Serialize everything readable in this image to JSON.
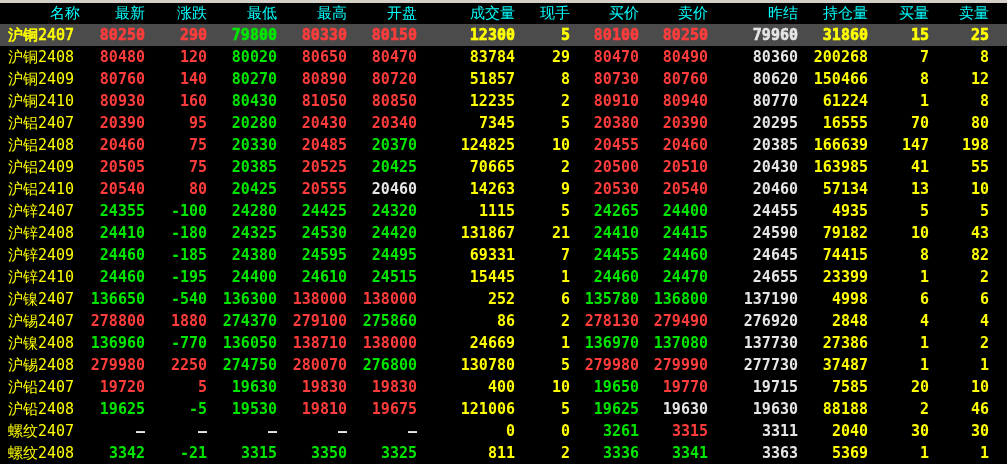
{
  "table": {
    "columns": [
      "名称",
      "最新",
      "涨跌",
      "最低",
      "最高",
      "开盘",
      "成交量",
      "现手",
      "买价",
      "卖价",
      "昨结",
      "持仓量",
      "买量",
      "卖量"
    ],
    "rows": [
      {
        "selected": true,
        "cells": [
          {
            "text": "沪铜2407",
            "color": "#ffff00"
          },
          {
            "text": "80250",
            "color": "#ff3c3c"
          },
          {
            "text": "290",
            "color": "#ff3c3c"
          },
          {
            "text": "79800",
            "color": "#00e600"
          },
          {
            "text": "80330",
            "color": "#ff3c3c"
          },
          {
            "text": "80150",
            "color": "#ff3c3c"
          },
          {
            "text": "12300",
            "color": "#ffff00"
          },
          {
            "text": "5",
            "color": "#ffff00"
          },
          {
            "text": "80100",
            "color": "#ff3c3c"
          },
          {
            "text": "80250",
            "color": "#ff3c3c"
          },
          {
            "text": "79960",
            "color": "#e6e6e6"
          },
          {
            "text": "31860",
            "color": "#ffff00"
          },
          {
            "text": "15",
            "color": "#ffff00"
          },
          {
            "text": "25",
            "color": "#ffff00"
          }
        ]
      },
      {
        "selected": false,
        "cells": [
          {
            "text": "沪铜2408",
            "color": "#ffff00"
          },
          {
            "text": "80480",
            "color": "#ff3c3c"
          },
          {
            "text": "120",
            "color": "#ff3c3c"
          },
          {
            "text": "80020",
            "color": "#00e600"
          },
          {
            "text": "80650",
            "color": "#ff3c3c"
          },
          {
            "text": "80470",
            "color": "#ff3c3c"
          },
          {
            "text": "83784",
            "color": "#ffff00"
          },
          {
            "text": "29",
            "color": "#ffff00"
          },
          {
            "text": "80470",
            "color": "#ff3c3c"
          },
          {
            "text": "80490",
            "color": "#ff3c3c"
          },
          {
            "text": "80360",
            "color": "#e6e6e6"
          },
          {
            "text": "200268",
            "color": "#ffff00"
          },
          {
            "text": "7",
            "color": "#ffff00"
          },
          {
            "text": "8",
            "color": "#ffff00"
          }
        ]
      },
      {
        "selected": false,
        "cells": [
          {
            "text": "沪铜2409",
            "color": "#ffff00"
          },
          {
            "text": "80760",
            "color": "#ff3c3c"
          },
          {
            "text": "140",
            "color": "#ff3c3c"
          },
          {
            "text": "80270",
            "color": "#00e600"
          },
          {
            "text": "80890",
            "color": "#ff3c3c"
          },
          {
            "text": "80720",
            "color": "#ff3c3c"
          },
          {
            "text": "51857",
            "color": "#ffff00"
          },
          {
            "text": "8",
            "color": "#ffff00"
          },
          {
            "text": "80730",
            "color": "#ff3c3c"
          },
          {
            "text": "80760",
            "color": "#ff3c3c"
          },
          {
            "text": "80620",
            "color": "#e6e6e6"
          },
          {
            "text": "150466",
            "color": "#ffff00"
          },
          {
            "text": "8",
            "color": "#ffff00"
          },
          {
            "text": "12",
            "color": "#ffff00"
          }
        ]
      },
      {
        "selected": false,
        "cells": [
          {
            "text": "沪铜2410",
            "color": "#ffff00"
          },
          {
            "text": "80930",
            "color": "#ff3c3c"
          },
          {
            "text": "160",
            "color": "#ff3c3c"
          },
          {
            "text": "80430",
            "color": "#00e600"
          },
          {
            "text": "81050",
            "color": "#ff3c3c"
          },
          {
            "text": "80850",
            "color": "#ff3c3c"
          },
          {
            "text": "12235",
            "color": "#ffff00"
          },
          {
            "text": "2",
            "color": "#ffff00"
          },
          {
            "text": "80910",
            "color": "#ff3c3c"
          },
          {
            "text": "80940",
            "color": "#ff3c3c"
          },
          {
            "text": "80770",
            "color": "#e6e6e6"
          },
          {
            "text": "61224",
            "color": "#ffff00"
          },
          {
            "text": "1",
            "color": "#ffff00"
          },
          {
            "text": "8",
            "color": "#ffff00"
          }
        ]
      },
      {
        "selected": false,
        "cells": [
          {
            "text": "沪铝2407",
            "color": "#ffff00"
          },
          {
            "text": "20390",
            "color": "#ff3c3c"
          },
          {
            "text": "95",
            "color": "#ff3c3c"
          },
          {
            "text": "20280",
            "color": "#00e600"
          },
          {
            "text": "20430",
            "color": "#ff3c3c"
          },
          {
            "text": "20340",
            "color": "#ff3c3c"
          },
          {
            "text": "7345",
            "color": "#ffff00"
          },
          {
            "text": "5",
            "color": "#ffff00"
          },
          {
            "text": "20380",
            "color": "#ff3c3c"
          },
          {
            "text": "20390",
            "color": "#ff3c3c"
          },
          {
            "text": "20295",
            "color": "#e6e6e6"
          },
          {
            "text": "16555",
            "color": "#ffff00"
          },
          {
            "text": "70",
            "color": "#ffff00"
          },
          {
            "text": "80",
            "color": "#ffff00"
          }
        ]
      },
      {
        "selected": false,
        "cells": [
          {
            "text": "沪铝2408",
            "color": "#ffff00"
          },
          {
            "text": "20460",
            "color": "#ff3c3c"
          },
          {
            "text": "75",
            "color": "#ff3c3c"
          },
          {
            "text": "20330",
            "color": "#00e600"
          },
          {
            "text": "20485",
            "color": "#ff3c3c"
          },
          {
            "text": "20370",
            "color": "#00e600"
          },
          {
            "text": "124825",
            "color": "#ffff00"
          },
          {
            "text": "10",
            "color": "#ffff00"
          },
          {
            "text": "20455",
            "color": "#ff3c3c"
          },
          {
            "text": "20460",
            "color": "#ff3c3c"
          },
          {
            "text": "20385",
            "color": "#e6e6e6"
          },
          {
            "text": "166639",
            "color": "#ffff00"
          },
          {
            "text": "147",
            "color": "#ffff00"
          },
          {
            "text": "198",
            "color": "#ffff00"
          }
        ]
      },
      {
        "selected": false,
        "cells": [
          {
            "text": "沪铝2409",
            "color": "#ffff00"
          },
          {
            "text": "20505",
            "color": "#ff3c3c"
          },
          {
            "text": "75",
            "color": "#ff3c3c"
          },
          {
            "text": "20385",
            "color": "#00e600"
          },
          {
            "text": "20525",
            "color": "#ff3c3c"
          },
          {
            "text": "20425",
            "color": "#00e600"
          },
          {
            "text": "70665",
            "color": "#ffff00"
          },
          {
            "text": "2",
            "color": "#ffff00"
          },
          {
            "text": "20500",
            "color": "#ff3c3c"
          },
          {
            "text": "20510",
            "color": "#ff3c3c"
          },
          {
            "text": "20430",
            "color": "#e6e6e6"
          },
          {
            "text": "163985",
            "color": "#ffff00"
          },
          {
            "text": "41",
            "color": "#ffff00"
          },
          {
            "text": "55",
            "color": "#ffff00"
          }
        ]
      },
      {
        "selected": false,
        "cells": [
          {
            "text": "沪铝2410",
            "color": "#ffff00"
          },
          {
            "text": "20540",
            "color": "#ff3c3c"
          },
          {
            "text": "80",
            "color": "#ff3c3c"
          },
          {
            "text": "20425",
            "color": "#00e600"
          },
          {
            "text": "20555",
            "color": "#ff3c3c"
          },
          {
            "text": "20460",
            "color": "#e6e6e6"
          },
          {
            "text": "14263",
            "color": "#ffff00"
          },
          {
            "text": "9",
            "color": "#ffff00"
          },
          {
            "text": "20530",
            "color": "#ff3c3c"
          },
          {
            "text": "20540",
            "color": "#ff3c3c"
          },
          {
            "text": "20460",
            "color": "#e6e6e6"
          },
          {
            "text": "57134",
            "color": "#ffff00"
          },
          {
            "text": "13",
            "color": "#ffff00"
          },
          {
            "text": "10",
            "color": "#ffff00"
          }
        ]
      },
      {
        "selected": false,
        "cells": [
          {
            "text": "沪锌2407",
            "color": "#ffff00"
          },
          {
            "text": "24355",
            "color": "#00e600"
          },
          {
            "text": "-100",
            "color": "#00e600"
          },
          {
            "text": "24280",
            "color": "#00e600"
          },
          {
            "text": "24425",
            "color": "#00e600"
          },
          {
            "text": "24320",
            "color": "#00e600"
          },
          {
            "text": "1115",
            "color": "#ffff00"
          },
          {
            "text": "5",
            "color": "#ffff00"
          },
          {
            "text": "24265",
            "color": "#00e600"
          },
          {
            "text": "24400",
            "color": "#00e600"
          },
          {
            "text": "24455",
            "color": "#e6e6e6"
          },
          {
            "text": "4935",
            "color": "#ffff00"
          },
          {
            "text": "5",
            "color": "#ffff00"
          },
          {
            "text": "5",
            "color": "#ffff00"
          }
        ]
      },
      {
        "selected": false,
        "cells": [
          {
            "text": "沪锌2408",
            "color": "#ffff00"
          },
          {
            "text": "24410",
            "color": "#00e600"
          },
          {
            "text": "-180",
            "color": "#00e600"
          },
          {
            "text": "24325",
            "color": "#00e600"
          },
          {
            "text": "24530",
            "color": "#00e600"
          },
          {
            "text": "24420",
            "color": "#00e600"
          },
          {
            "text": "131867",
            "color": "#ffff00"
          },
          {
            "text": "21",
            "color": "#ffff00"
          },
          {
            "text": "24410",
            "color": "#00e600"
          },
          {
            "text": "24415",
            "color": "#00e600"
          },
          {
            "text": "24590",
            "color": "#e6e6e6"
          },
          {
            "text": "79182",
            "color": "#ffff00"
          },
          {
            "text": "10",
            "color": "#ffff00"
          },
          {
            "text": "43",
            "color": "#ffff00"
          }
        ]
      },
      {
        "selected": false,
        "cells": [
          {
            "text": "沪锌2409",
            "color": "#ffff00"
          },
          {
            "text": "24460",
            "color": "#00e600"
          },
          {
            "text": "-185",
            "color": "#00e600"
          },
          {
            "text": "24380",
            "color": "#00e600"
          },
          {
            "text": "24595",
            "color": "#00e600"
          },
          {
            "text": "24495",
            "color": "#00e600"
          },
          {
            "text": "69331",
            "color": "#ffff00"
          },
          {
            "text": "7",
            "color": "#ffff00"
          },
          {
            "text": "24455",
            "color": "#00e600"
          },
          {
            "text": "24460",
            "color": "#00e600"
          },
          {
            "text": "24645",
            "color": "#e6e6e6"
          },
          {
            "text": "74415",
            "color": "#ffff00"
          },
          {
            "text": "8",
            "color": "#ffff00"
          },
          {
            "text": "82",
            "color": "#ffff00"
          }
        ]
      },
      {
        "selected": false,
        "cells": [
          {
            "text": "沪锌2410",
            "color": "#ffff00"
          },
          {
            "text": "24460",
            "color": "#00e600"
          },
          {
            "text": "-195",
            "color": "#00e600"
          },
          {
            "text": "24400",
            "color": "#00e600"
          },
          {
            "text": "24610",
            "color": "#00e600"
          },
          {
            "text": "24515",
            "color": "#00e600"
          },
          {
            "text": "15445",
            "color": "#ffff00"
          },
          {
            "text": "1",
            "color": "#ffff00"
          },
          {
            "text": "24460",
            "color": "#00e600"
          },
          {
            "text": "24470",
            "color": "#00e600"
          },
          {
            "text": "24655",
            "color": "#e6e6e6"
          },
          {
            "text": "23399",
            "color": "#ffff00"
          },
          {
            "text": "1",
            "color": "#ffff00"
          },
          {
            "text": "2",
            "color": "#ffff00"
          }
        ]
      },
      {
        "selected": false,
        "cells": [
          {
            "text": "沪镍2407",
            "color": "#ffff00"
          },
          {
            "text": "136650",
            "color": "#00e600"
          },
          {
            "text": "-540",
            "color": "#00e600"
          },
          {
            "text": "136300",
            "color": "#00e600"
          },
          {
            "text": "138000",
            "color": "#ff3c3c"
          },
          {
            "text": "138000",
            "color": "#ff3c3c"
          },
          {
            "text": "252",
            "color": "#ffff00"
          },
          {
            "text": "6",
            "color": "#ffff00"
          },
          {
            "text": "135780",
            "color": "#00e600"
          },
          {
            "text": "136800",
            "color": "#00e600"
          },
          {
            "text": "137190",
            "color": "#e6e6e6"
          },
          {
            "text": "4998",
            "color": "#ffff00"
          },
          {
            "text": "6",
            "color": "#ffff00"
          },
          {
            "text": "6",
            "color": "#ffff00"
          }
        ]
      },
      {
        "selected": false,
        "cells": [
          {
            "text": "沪锡2407",
            "color": "#ffff00"
          },
          {
            "text": "278800",
            "color": "#ff3c3c"
          },
          {
            "text": "1880",
            "color": "#ff3c3c"
          },
          {
            "text": "274370",
            "color": "#00e600"
          },
          {
            "text": "279100",
            "color": "#ff3c3c"
          },
          {
            "text": "275860",
            "color": "#00e600"
          },
          {
            "text": "86",
            "color": "#ffff00"
          },
          {
            "text": "2",
            "color": "#ffff00"
          },
          {
            "text": "278130",
            "color": "#ff3c3c"
          },
          {
            "text": "279490",
            "color": "#ff3c3c"
          },
          {
            "text": "276920",
            "color": "#e6e6e6"
          },
          {
            "text": "2848",
            "color": "#ffff00"
          },
          {
            "text": "4",
            "color": "#ffff00"
          },
          {
            "text": "4",
            "color": "#ffff00"
          }
        ]
      },
      {
        "selected": false,
        "cells": [
          {
            "text": "沪镍2408",
            "color": "#ffff00"
          },
          {
            "text": "136960",
            "color": "#00e600"
          },
          {
            "text": "-770",
            "color": "#00e600"
          },
          {
            "text": "136050",
            "color": "#00e600"
          },
          {
            "text": "138710",
            "color": "#ff3c3c"
          },
          {
            "text": "138000",
            "color": "#ff3c3c"
          },
          {
            "text": "24669",
            "color": "#ffff00"
          },
          {
            "text": "1",
            "color": "#ffff00"
          },
          {
            "text": "136970",
            "color": "#00e600"
          },
          {
            "text": "137080",
            "color": "#00e600"
          },
          {
            "text": "137730",
            "color": "#e6e6e6"
          },
          {
            "text": "27386",
            "color": "#ffff00"
          },
          {
            "text": "1",
            "color": "#ffff00"
          },
          {
            "text": "2",
            "color": "#ffff00"
          }
        ]
      },
      {
        "selected": false,
        "cells": [
          {
            "text": "沪锡2408",
            "color": "#ffff00"
          },
          {
            "text": "279980",
            "color": "#ff3c3c"
          },
          {
            "text": "2250",
            "color": "#ff3c3c"
          },
          {
            "text": "274750",
            "color": "#00e600"
          },
          {
            "text": "280070",
            "color": "#ff3c3c"
          },
          {
            "text": "276800",
            "color": "#00e600"
          },
          {
            "text": "130780",
            "color": "#ffff00"
          },
          {
            "text": "5",
            "color": "#ffff00"
          },
          {
            "text": "279980",
            "color": "#ff3c3c"
          },
          {
            "text": "279990",
            "color": "#ff3c3c"
          },
          {
            "text": "277730",
            "color": "#e6e6e6"
          },
          {
            "text": "37487",
            "color": "#ffff00"
          },
          {
            "text": "1",
            "color": "#ffff00"
          },
          {
            "text": "1",
            "color": "#ffff00"
          }
        ]
      },
      {
        "selected": false,
        "cells": [
          {
            "text": "沪铅2407",
            "color": "#ffff00"
          },
          {
            "text": "19720",
            "color": "#ff3c3c"
          },
          {
            "text": "5",
            "color": "#ff3c3c"
          },
          {
            "text": "19630",
            "color": "#00e600"
          },
          {
            "text": "19830",
            "color": "#ff3c3c"
          },
          {
            "text": "19830",
            "color": "#ff3c3c"
          },
          {
            "text": "400",
            "color": "#ffff00"
          },
          {
            "text": "10",
            "color": "#ffff00"
          },
          {
            "text": "19650",
            "color": "#00e600"
          },
          {
            "text": "19770",
            "color": "#ff3c3c"
          },
          {
            "text": "19715",
            "color": "#e6e6e6"
          },
          {
            "text": "7585",
            "color": "#ffff00"
          },
          {
            "text": "20",
            "color": "#ffff00"
          },
          {
            "text": "10",
            "color": "#ffff00"
          }
        ]
      },
      {
        "selected": false,
        "cells": [
          {
            "text": "沪铅2408",
            "color": "#ffff00"
          },
          {
            "text": "19625",
            "color": "#00e600"
          },
          {
            "text": "-5",
            "color": "#00e600"
          },
          {
            "text": "19530",
            "color": "#00e600"
          },
          {
            "text": "19810",
            "color": "#ff3c3c"
          },
          {
            "text": "19675",
            "color": "#ff3c3c"
          },
          {
            "text": "121006",
            "color": "#ffff00"
          },
          {
            "text": "5",
            "color": "#ffff00"
          },
          {
            "text": "19625",
            "color": "#00e600"
          },
          {
            "text": "19630",
            "color": "#e6e6e6"
          },
          {
            "text": "19630",
            "color": "#e6e6e6"
          },
          {
            "text": "88188",
            "color": "#ffff00"
          },
          {
            "text": "2",
            "color": "#ffff00"
          },
          {
            "text": "46",
            "color": "#ffff00"
          }
        ]
      },
      {
        "selected": false,
        "cells": [
          {
            "text": "螺纹2407",
            "color": "#ffff00"
          },
          {
            "text": "—",
            "color": "#e6e6e6"
          },
          {
            "text": "—",
            "color": "#e6e6e6"
          },
          {
            "text": "—",
            "color": "#e6e6e6"
          },
          {
            "text": "—",
            "color": "#e6e6e6"
          },
          {
            "text": "—",
            "color": "#e6e6e6"
          },
          {
            "text": "0",
            "color": "#ffff00"
          },
          {
            "text": "0",
            "color": "#ffff00"
          },
          {
            "text": "3261",
            "color": "#00e600"
          },
          {
            "text": "3315",
            "color": "#ff3c3c"
          },
          {
            "text": "3311",
            "color": "#e6e6e6"
          },
          {
            "text": "2040",
            "color": "#ffff00"
          },
          {
            "text": "30",
            "color": "#ffff00"
          },
          {
            "text": "30",
            "color": "#ffff00"
          }
        ]
      },
      {
        "selected": false,
        "cells": [
          {
            "text": "螺纹2408",
            "color": "#ffff00"
          },
          {
            "text": "3342",
            "color": "#00e600"
          },
          {
            "text": "-21",
            "color": "#00e600"
          },
          {
            "text": "3315",
            "color": "#00e600"
          },
          {
            "text": "3350",
            "color": "#00e600"
          },
          {
            "text": "3325",
            "color": "#00e600"
          },
          {
            "text": "811",
            "color": "#ffff00"
          },
          {
            "text": "2",
            "color": "#ffff00"
          },
          {
            "text": "3336",
            "color": "#00e600"
          },
          {
            "text": "3341",
            "color": "#00e600"
          },
          {
            "text": "3363",
            "color": "#e6e6e6"
          },
          {
            "text": "5369",
            "color": "#ffff00"
          },
          {
            "text": "1",
            "color": "#ffff00"
          },
          {
            "text": "1",
            "color": "#ffff00"
          }
        ]
      }
    ]
  }
}
